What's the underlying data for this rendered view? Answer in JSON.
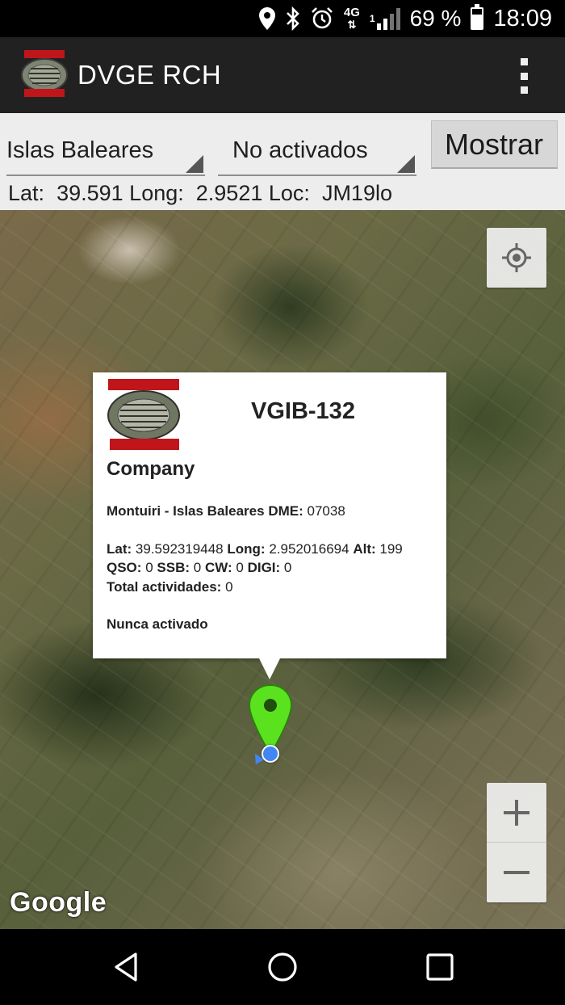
{
  "status_bar": {
    "icons": [
      "location-icon",
      "bluetooth-icon",
      "alarm-icon",
      "network-4g-icon",
      "signal-icon",
      "battery-icon"
    ],
    "network": "4G",
    "sim": "1",
    "battery_level": 0.69,
    "battery": "69 %",
    "time": "18:09"
  },
  "app_bar": {
    "logo": "radio-club-henares-logo",
    "title": "DVGE RCH",
    "menu_icon": "overflow-menu-icon"
  },
  "filters": {
    "region": "Islas Baleares",
    "status": "No activados",
    "show_button": "Mostrar"
  },
  "location": {
    "lat_label": "Lat:",
    "lat": "39.591",
    "long_label": "Long:",
    "long": "2.9521",
    "loc_label": "Loc:",
    "loc": "JM19lo"
  },
  "map": {
    "attribution": "Google",
    "my_location_icon": "my-location-icon",
    "zoom_in": "+",
    "zoom_out": "−"
  },
  "info_window": {
    "logo": "radio-club-henares-logo",
    "code": "VGIB-132",
    "name": "Company",
    "place": "Montuiri - Islas Baleares",
    "dme_label": "DME:",
    "dme": "07038",
    "lat_label": "Lat:",
    "lat": "39.592319448",
    "long_label": "Long:",
    "long": "2.952016694",
    "alt_label": "Alt:",
    "alt": "199",
    "qso_label": "QSO:",
    "qso": "0",
    "ssb_label": "SSB:",
    "ssb": "0",
    "cw_label": "CW:",
    "cw": "0",
    "digi_label": "DIGI:",
    "digi": "0",
    "total_label": "Total actividades:",
    "total": "0",
    "status": "Nunca activado"
  },
  "nav_bar": {
    "icons": [
      "back-icon",
      "home-icon",
      "recents-icon"
    ]
  }
}
